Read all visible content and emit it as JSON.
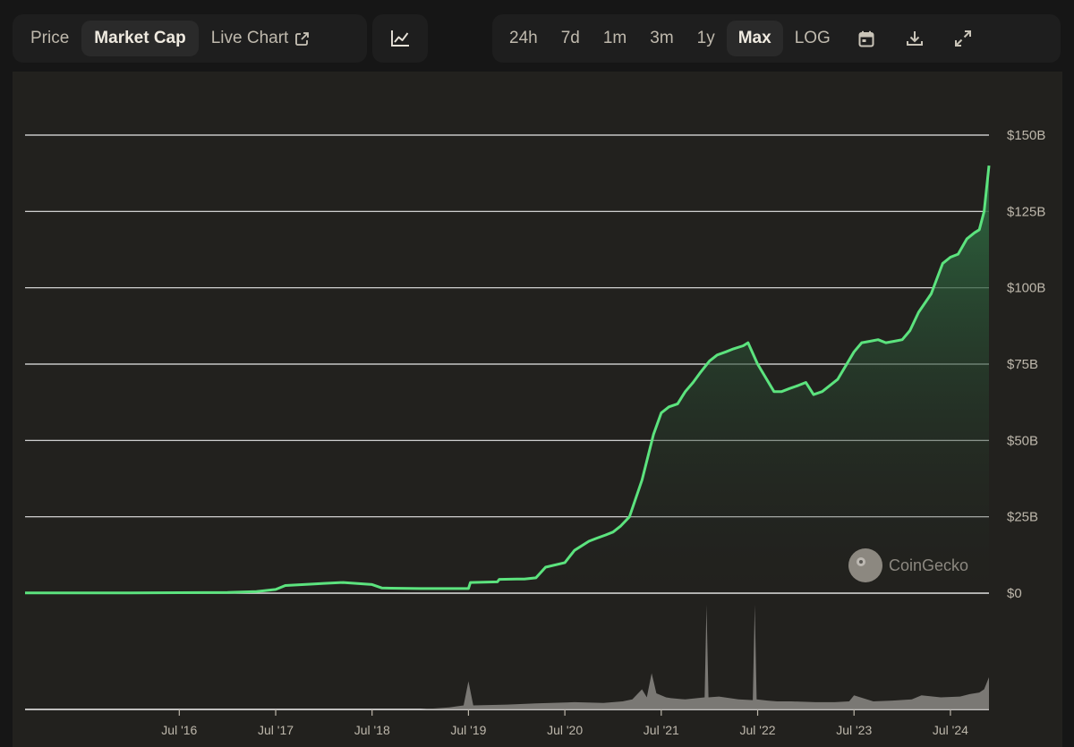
{
  "toolbar": {
    "metric_tabs": [
      {
        "label": "Price",
        "active": false
      },
      {
        "label": "Market Cap",
        "active": true
      },
      {
        "label": "Live Chart",
        "active": false,
        "icon": "external-link-icon"
      }
    ],
    "chart_type_icon": "line-chart-icon",
    "ranges": [
      {
        "label": "24h",
        "active": false
      },
      {
        "label": "7d",
        "active": false
      },
      {
        "label": "1m",
        "active": false
      },
      {
        "label": "3m",
        "active": false
      },
      {
        "label": "1y",
        "active": false
      },
      {
        "label": "Max",
        "active": true
      },
      {
        "label": "LOG",
        "active": false
      }
    ],
    "icons": [
      "calendar-icon",
      "download-icon",
      "fullscreen-icon"
    ]
  },
  "watermark": "CoinGecko",
  "colors": {
    "line": "#5ce37e",
    "area_top": "#2e6f43",
    "grid": "#f2f2f2",
    "volume": "#8a8784",
    "background": "#22211e"
  },
  "chart_data": {
    "type": "area",
    "title": "",
    "xlabel": "",
    "ylabel": "",
    "ylim": [
      0,
      150
    ],
    "y_unit": "B",
    "y_ticks": [
      "$0",
      "$25B",
      "$50B",
      "$75B",
      "$100B",
      "$125B",
      "$150B"
    ],
    "x_ticks": [
      "Jul '16",
      "Jul '17",
      "Jul '18",
      "Jul '19",
      "Jul '20",
      "Jul '21",
      "Jul '22",
      "Jul '23",
      "Jul '24"
    ],
    "grid": true,
    "x": [
      2014.9,
      2016.0,
      2017.0,
      2017.3,
      2017.5,
      2017.6,
      2017.9,
      2018.0,
      2018.2,
      2018.5,
      2018.6,
      2018.7,
      2019.0,
      2019.3,
      2019.5,
      2019.52,
      2019.8,
      2019.82,
      2020.0,
      2020.08,
      2020.2,
      2020.3,
      2020.5,
      2020.6,
      2020.75,
      2020.83,
      2020.92,
      2021.0,
      2021.08,
      2021.17,
      2021.3,
      2021.42,
      2021.5,
      2021.58,
      2021.67,
      2021.75,
      2021.83,
      2021.9,
      2022.0,
      2022.08,
      2022.17,
      2022.25,
      2022.35,
      2022.4,
      2022.5,
      2022.67,
      2022.75,
      2022.83,
      2022.92,
      2023.0,
      2023.08,
      2023.17,
      2023.33,
      2023.5,
      2023.58,
      2023.67,
      2023.75,
      2023.83,
      2023.92,
      2024.0,
      2024.08,
      2024.17,
      2024.3,
      2024.42,
      2024.5,
      2024.58,
      2024.67,
      2024.75,
      2024.8,
      2024.85,
      2024.9
    ],
    "series": [
      {
        "values": [
          0.05,
          0.1,
          0.2,
          0.5,
          1.2,
          2.5,
          3.0,
          3.2,
          3.5,
          2.8,
          1.7,
          1.6,
          1.5,
          1.5,
          1.5,
          3.5,
          3.7,
          4.5,
          4.6,
          4.6,
          5.0,
          8.5,
          10.0,
          14.0,
          17.0,
          18.0,
          19.0,
          20.0,
          22.0,
          25.0,
          37.0,
          52.0,
          59.0,
          61.0,
          62.0,
          66.0,
          69.0,
          72.0,
          76.0,
          78.0,
          79.0,
          80.0,
          81.0,
          82.0,
          75.0,
          66.0,
          66.0,
          67.0,
          68.0,
          69.0,
          65.0,
          66.0,
          70.0,
          79.0,
          82.0,
          82.5,
          83.0,
          82.0,
          82.5,
          83.0,
          86.0,
          92.0,
          98.0,
          108.0,
          110.0,
          111.0,
          116.0,
          118.0,
          119.0,
          125.0,
          140.0
        ]
      }
    ],
    "volume": {
      "x": [
        2014.9,
        2017.5,
        2018.5,
        2019.0,
        2019.3,
        2019.45,
        2019.5,
        2019.55,
        2019.9,
        2020.2,
        2020.6,
        2020.9,
        2021.1,
        2021.2,
        2021.3,
        2021.35,
        2021.4,
        2021.45,
        2021.5,
        2021.55,
        2021.6,
        2021.75,
        2021.95,
        2021.97,
        2021.99,
        2022.1,
        2022.3,
        2022.45,
        2022.47,
        2022.49,
        2022.6,
        2022.7,
        2022.85,
        2023.1,
        2023.3,
        2023.45,
        2023.5,
        2023.7,
        2023.9,
        2024.1,
        2024.2,
        2024.4,
        2024.6,
        2024.7,
        2024.8,
        2024.85,
        2024.9
      ],
      "values": [
        0,
        0,
        0,
        0,
        0.5,
        1,
        7,
        1,
        1.2,
        1.5,
        1.8,
        1.6,
        2,
        2.5,
        5,
        3,
        9,
        4,
        3.5,
        3,
        2.8,
        2.5,
        3,
        26,
        3,
        3.2,
        2.5,
        2.3,
        26,
        2.5,
        2.2,
        2,
        2,
        1.8,
        1.8,
        2,
        3.5,
        2,
        2.2,
        2.5,
        3.5,
        3,
        3.2,
        3.8,
        4.2,
        5,
        8
      ]
    }
  }
}
